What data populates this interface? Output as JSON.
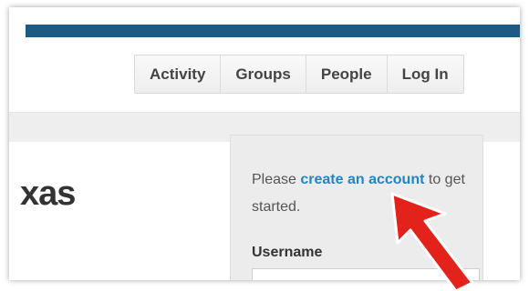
{
  "nav": {
    "items": [
      "Activity",
      "Groups",
      "People",
      "Log In"
    ]
  },
  "logo": {
    "partial_text": "xas"
  },
  "login": {
    "prompt_before": "Please ",
    "create_link": "create an account",
    "prompt_after": " to get started.",
    "username_label": "Username",
    "username_value": ""
  },
  "colors": {
    "top_bar": "#1d5b84",
    "link": "#1f86c4",
    "arrow": "#e3231b"
  },
  "annotation": {
    "icon": "red-arrow-icon"
  }
}
